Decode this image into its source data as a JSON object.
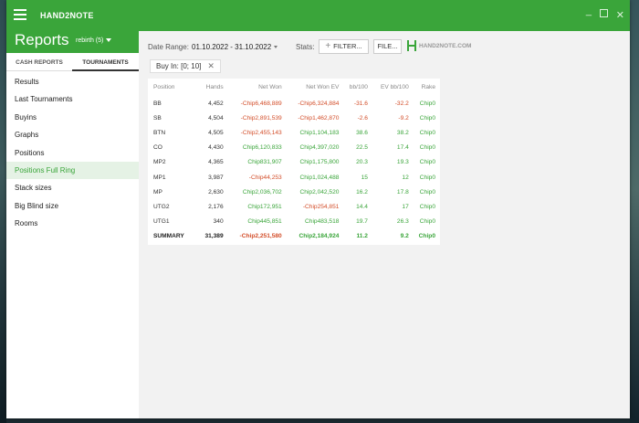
{
  "app": {
    "name": "HAND2NOTE"
  },
  "reports": {
    "title": "Reports",
    "profile": "rebirth (5)"
  },
  "tabs": [
    {
      "label": "CASH REPORTS"
    },
    {
      "label": "TOURNAMENTS"
    }
  ],
  "nav": [
    {
      "label": "Results"
    },
    {
      "label": "Last Tournaments"
    },
    {
      "label": "Buyins"
    },
    {
      "label": "Graphs"
    },
    {
      "label": "Positions"
    },
    {
      "label": "Positions Full Ring",
      "active": true
    },
    {
      "label": "Stack sizes"
    },
    {
      "label": "Big Blind size"
    },
    {
      "label": "Rooms"
    }
  ],
  "filters": {
    "date_label": "Date Range:",
    "date_value": "01.10.2022 - 31.10.2022",
    "stats_label": "Stats:",
    "filter_btn": "FILTER...",
    "file_btn": "FILE...",
    "logo_text": "HAND2NOTE.COM",
    "active_filter": "Buy In: [0; 10]"
  },
  "table": {
    "columns": [
      "Position",
      "Hands",
      "Net Won",
      "Net Won EV",
      "bb/100",
      "EV bb/100",
      "Rake"
    ],
    "rows": [
      [
        "BB",
        "4,452",
        "-Chip6,468,889",
        "-Chip6,324,884",
        "-31.6",
        "-32.2",
        "Chip0"
      ],
      [
        "SB",
        "4,504",
        "-Chip2,891,539",
        "-Chip1,462,870",
        "-2.6",
        "-9.2",
        "Chip0"
      ],
      [
        "BTN",
        "4,505",
        "-Chip2,455,143",
        "Chip1,104,183",
        "38.6",
        "38.2",
        "Chip0"
      ],
      [
        "CO",
        "4,430",
        "Chip6,120,833",
        "Chip4,397,020",
        "22.5",
        "17.4",
        "Chip0"
      ],
      [
        "MP2",
        "4,365",
        "Chip831,907",
        "Chip1,175,800",
        "20.3",
        "19.3",
        "Chip0"
      ],
      [
        "MP1",
        "3,987",
        "-Chip44,253",
        "Chip1,024,488",
        "15",
        "12",
        "Chip0"
      ],
      [
        "MP",
        "2,630",
        "Chip2,036,702",
        "Chip2,042,520",
        "16.2",
        "17.8",
        "Chip0"
      ],
      [
        "UTG2",
        "2,176",
        "Chip172,951",
        "-Chip254,851",
        "14.4",
        "17",
        "Chip0"
      ],
      [
        "UTG1",
        "340",
        "Chip445,851",
        "Chip483,518",
        "19.7",
        "26.3",
        "Chip0"
      ]
    ],
    "summary": [
      "SUMMARY",
      "31,389",
      "-Chip2,251,580",
      "Chip2,184,924",
      "11.2",
      "9.2",
      "Chip0"
    ]
  },
  "colors": {
    "accent": "#3aa53a",
    "negative": "#d34e2a"
  }
}
